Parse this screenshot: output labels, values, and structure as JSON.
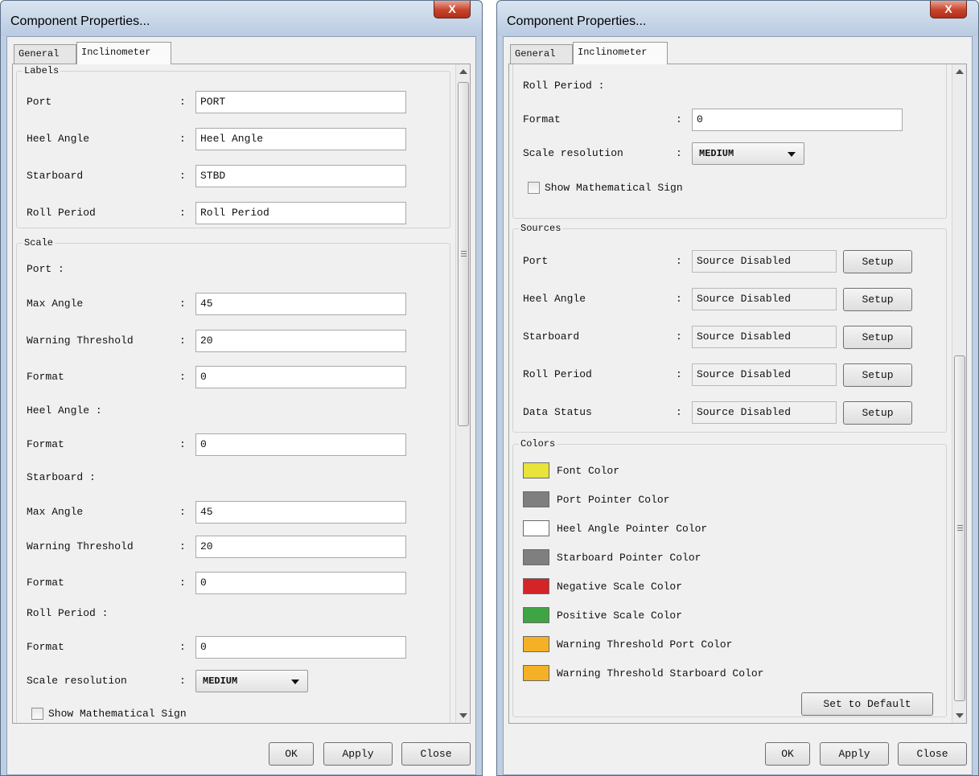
{
  "left_dialog": {
    "title": "Component Properties...",
    "close_glyph": "X",
    "tabs": {
      "general": "General",
      "inclinometer": "Inclinometer"
    },
    "labels_group": {
      "legend": "Labels",
      "rows": [
        {
          "label": "Port",
          "value": "PORT"
        },
        {
          "label": "Heel Angle",
          "value": "Heel Angle"
        },
        {
          "label": "Starboard",
          "value": "STBD"
        },
        {
          "label": "Roll Period",
          "value": "Roll Period"
        }
      ]
    },
    "scale_group": {
      "legend": "Scale",
      "port_heading": "Port :",
      "port_max_angle": {
        "label": "Max Angle",
        "value": "45"
      },
      "port_warning": {
        "label": "Warning Threshold",
        "value": "20"
      },
      "port_format": {
        "label": "Format",
        "value": "0"
      },
      "heel_heading": "Heel Angle :",
      "heel_format": {
        "label": "Format",
        "value": "0"
      },
      "stbd_heading": "Starboard :",
      "stbd_max_angle": {
        "label": "Max Angle",
        "value": "45"
      },
      "stbd_warning": {
        "label": "Warning Threshold",
        "value": "20"
      },
      "stbd_format": {
        "label": "Format",
        "value": "0"
      },
      "roll_heading": "Roll Period :",
      "roll_format": {
        "label": "Format",
        "value": "0"
      },
      "resolution": {
        "label": "Scale resolution",
        "value": "MEDIUM"
      },
      "show_sign": "Show Mathematical Sign"
    },
    "colon": ":",
    "buttons": {
      "ok": "OK",
      "apply": "Apply",
      "close": "Close"
    }
  },
  "right_dialog": {
    "title": "Component Properties...",
    "close_glyph": "X",
    "tabs": {
      "general": "General",
      "inclinometer": "Inclinometer"
    },
    "scale_tail": {
      "roll_heading": "Roll Period :",
      "roll_format": {
        "label": "Format",
        "value": "0"
      },
      "resolution": {
        "label": "Scale resolution",
        "value": "MEDIUM"
      },
      "show_sign": "Show Mathematical Sign"
    },
    "sources_group": {
      "legend": "Sources",
      "setup_label": "Setup",
      "rows": [
        {
          "label": "Port",
          "value": "Source Disabled"
        },
        {
          "label": "Heel Angle",
          "value": "Source Disabled"
        },
        {
          "label": "Starboard",
          "value": "Source Disabled"
        },
        {
          "label": "Roll Period",
          "value": "Source Disabled"
        },
        {
          "label": "Data Status",
          "value": "Source Disabled"
        }
      ]
    },
    "colors_group": {
      "legend": "Colors",
      "items": [
        {
          "name": "Font Color",
          "color": "#e8e43a"
        },
        {
          "name": "Port Pointer Color",
          "color": "#7f7f7f"
        },
        {
          "name": "Heel Angle Pointer Color",
          "color": "#ffffff"
        },
        {
          "name": "Starboard Pointer Color",
          "color": "#7f7f7f"
        },
        {
          "name": "Negative Scale Color",
          "color": "#d42428"
        },
        {
          "name": "Positive Scale Color",
          "color": "#3fa443"
        },
        {
          "name": "Warning Threshold Port Color",
          "color": "#f4b126"
        },
        {
          "name": "Warning Threshold Starboard Color",
          "color": "#f4b126"
        }
      ],
      "default_button": "Set to Default"
    },
    "colon": ":",
    "buttons": {
      "ok": "OK",
      "apply": "Apply",
      "close": "Close"
    }
  }
}
